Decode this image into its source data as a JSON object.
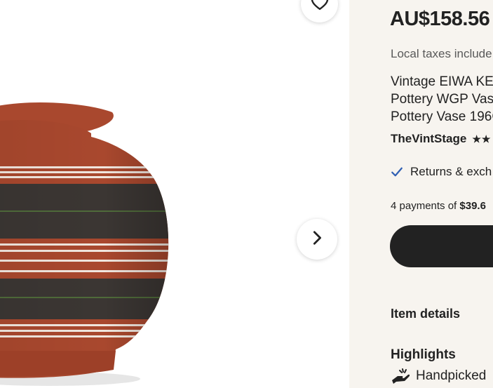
{
  "gallery": {
    "image_alt": "Vintage EIWA vase with red-brown, dark green and white stripes",
    "favorite_icon": "heart-outline-icon",
    "next_icon": "chevron-right-icon"
  },
  "listing": {
    "price": "AU$158.56",
    "taxes_note": "Local taxes include",
    "title_lines": [
      "Vintage EIWA KE",
      "Pottery WGP Vas",
      "Pottery Vase 196C"
    ],
    "shop_name": "TheVintStage",
    "rating_stars": "★★",
    "returns_text": "Returns & exch",
    "payments_prefix": "4 payments of ",
    "payments_amount": "$39.6",
    "item_details_heading": "Item details",
    "highlights_heading": "Highlights",
    "highlight_1": "Handpicked"
  },
  "colors": {
    "accent_blue": "#2f5fb3",
    "button_dark": "#222222",
    "panel_bg": "#f7f4ef"
  }
}
